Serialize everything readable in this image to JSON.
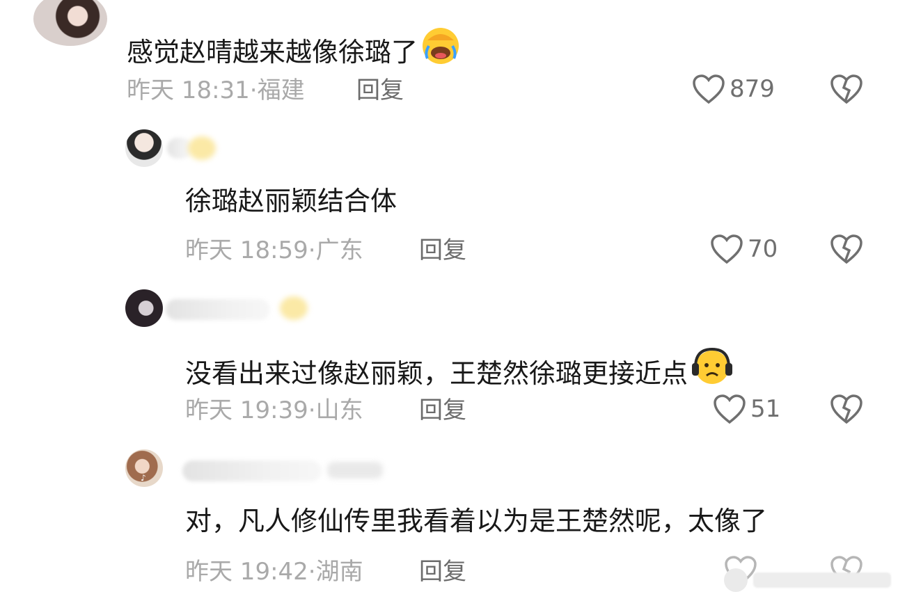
{
  "comments": [
    {
      "text": "感觉赵晴越来越像徐璐了",
      "time": "昨天 18:31",
      "location": "福建",
      "reply_label": "回复",
      "likes": "879",
      "emoji": "face-palm-laughing"
    },
    {
      "text": "徐璐赵丽颖结合体",
      "time": "昨天 18:59",
      "location": "广东",
      "reply_label": "回复",
      "likes": "70"
    },
    {
      "text": "没看出来过像赵丽颖，王楚然徐璐更接近点",
      "time": "昨天 19:39",
      "location": "山东",
      "reply_label": "回复",
      "likes": "51",
      "emoji": "worried-face-headphones"
    },
    {
      "text": "对，凡人修仙传里我看着以为是王楚然呢，太像了",
      "time": "昨天 19:42",
      "location": "湖南",
      "reply_label": "回复"
    }
  ],
  "meta_separator": "·",
  "colors": {
    "text": "#181818",
    "meta": "#a9a9a9",
    "reply": "#6b6b6b",
    "icon": "#6f6f6f"
  }
}
